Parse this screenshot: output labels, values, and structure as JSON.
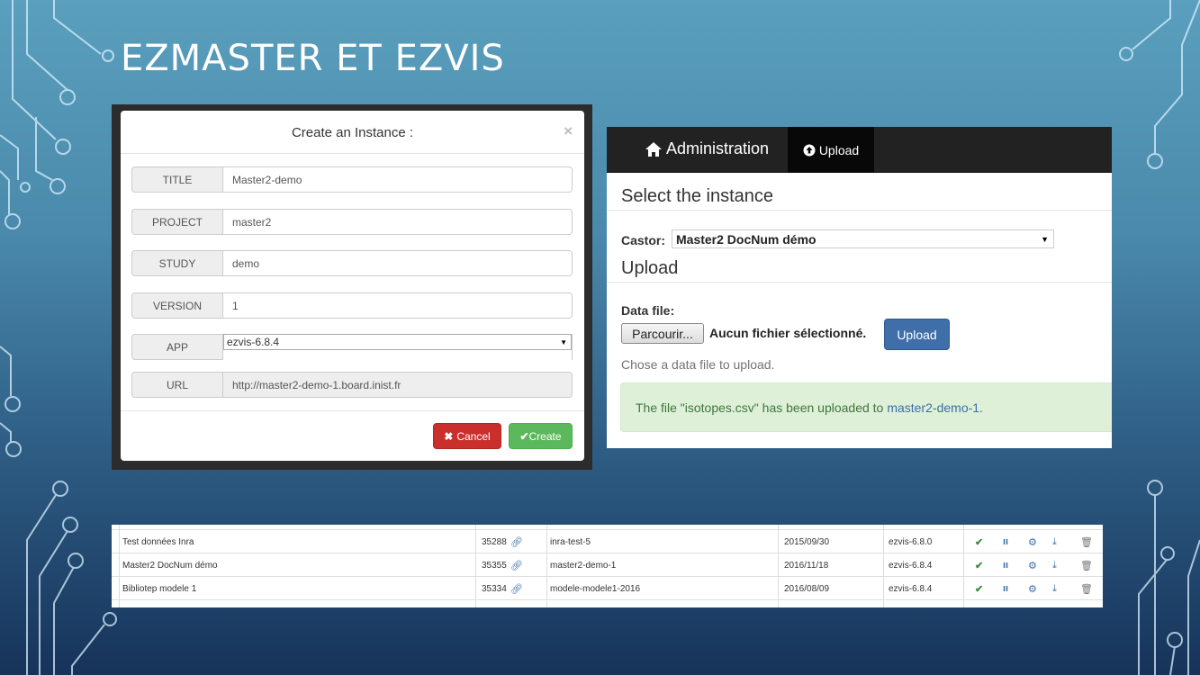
{
  "slide": {
    "title": "EZMASTER ET EZVIS"
  },
  "modal": {
    "title": "Create an Instance :",
    "close": "×",
    "fields": [
      {
        "label": "TITLE",
        "value": "Master2-demo"
      },
      {
        "label": "PROJECT",
        "value": "master2"
      },
      {
        "label": "STUDY",
        "value": "demo"
      },
      {
        "label": "VERSION",
        "value": "1"
      },
      {
        "label": "APP",
        "value": "ezvis-6.8.4"
      },
      {
        "label": "URL",
        "value": "http://master2-demo-1.board.inist.fr"
      }
    ],
    "cancel_label": "Cancel",
    "create_label": "Create"
  },
  "admin": {
    "brand": "Administration",
    "nav_upload": "Upload",
    "select_title": "Select the instance",
    "castor_label": "Castor:",
    "castor_value": "Master2 DocNum démo",
    "upload_title": "Upload",
    "datafile_label": "Data file:",
    "browse_label": "Parcourir...",
    "no_file": "Aucun fichier sélectionné.",
    "upload_button": "Upload",
    "help": "Chose a data file to upload.",
    "alert_text": "The file \"isotopes.csv\" has been uploaded to",
    "alert_link": "master2-demo-1",
    "alert_end": "."
  },
  "table": {
    "rows": [
      {
        "name": "Test données Inra",
        "port": "35288",
        "technical": "inra-test-5",
        "date": "2015/09/30",
        "app": "ezvis-6.8.0"
      },
      {
        "name": "Master2 DocNum démo",
        "port": "35355",
        "technical": "master2-demo-1",
        "date": "2016/11/18",
        "app": "ezvis-6.8.4"
      },
      {
        "name": "Bibliotep modele 1",
        "port": "35334",
        "technical": "modele-modele1-2016",
        "date": "2016/08/09",
        "app": "ezvis-6.8.4"
      }
    ]
  },
  "icons": {
    "home": "home-icon",
    "upload": "upload-circle-icon",
    "link": "link-icon",
    "check": "check-icon",
    "pause": "pause-icon",
    "settings": "gear-icon",
    "download": "download-icon",
    "delete": "trash-icon",
    "times": "remove-icon"
  },
  "colors": {
    "success": "#5cb85c",
    "danger": "#c9302c",
    "primary": "#3f6ea8",
    "navbar": "#222222",
    "alert_bg": "#dff0d8"
  }
}
